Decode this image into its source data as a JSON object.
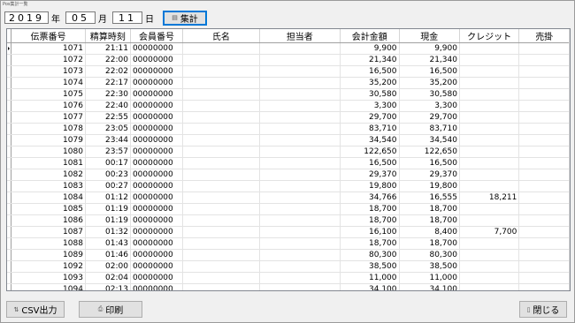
{
  "window_title": "Pos集計一覧",
  "date": {
    "year": "2019",
    "year_label": "年",
    "month": "05",
    "month_label": "月",
    "day": "11",
    "day_label": "日"
  },
  "aggregate_button": {
    "label": "集計",
    "icon": "aggregate-icon"
  },
  "table": {
    "columns": [
      "伝票番号",
      "精算時刻",
      "会員番号",
      "氏名",
      "担当者",
      "会計金額",
      "現金",
      "クレジット",
      "売掛"
    ],
    "rows": [
      [
        "1071",
        "21:11",
        "00000000",
        "",
        "",
        "9,900",
        "9,900",
        "",
        ""
      ],
      [
        "1072",
        "22:00",
        "00000000",
        "",
        "",
        "21,340",
        "21,340",
        "",
        ""
      ],
      [
        "1073",
        "22:02",
        "00000000",
        "",
        "",
        "16,500",
        "16,500",
        "",
        ""
      ],
      [
        "1074",
        "22:17",
        "00000000",
        "",
        "",
        "35,200",
        "35,200",
        "",
        ""
      ],
      [
        "1075",
        "22:30",
        "00000000",
        "",
        "",
        "30,580",
        "30,580",
        "",
        ""
      ],
      [
        "1076",
        "22:40",
        "00000000",
        "",
        "",
        "3,300",
        "3,300",
        "",
        ""
      ],
      [
        "1077",
        "22:55",
        "00000000",
        "",
        "",
        "29,700",
        "29,700",
        "",
        ""
      ],
      [
        "1078",
        "23:05",
        "00000000",
        "",
        "",
        "83,710",
        "83,710",
        "",
        ""
      ],
      [
        "1079",
        "23:44",
        "00000000",
        "",
        "",
        "34,540",
        "34,540",
        "",
        ""
      ],
      [
        "1080",
        "23:57",
        "00000000",
        "",
        "",
        "122,650",
        "122,650",
        "",
        ""
      ],
      [
        "1081",
        "00:17",
        "00000000",
        "",
        "",
        "16,500",
        "16,500",
        "",
        ""
      ],
      [
        "1082",
        "00:23",
        "00000000",
        "",
        "",
        "29,370",
        "29,370",
        "",
        ""
      ],
      [
        "1083",
        "00:27",
        "00000000",
        "",
        "",
        "19,800",
        "19,800",
        "",
        ""
      ],
      [
        "1084",
        "01:12",
        "00000000",
        "",
        "",
        "34,766",
        "16,555",
        "18,211",
        ""
      ],
      [
        "1085",
        "01:19",
        "00000000",
        "",
        "",
        "18,700",
        "18,700",
        "",
        ""
      ],
      [
        "1086",
        "01:19",
        "00000000",
        "",
        "",
        "18,700",
        "18,700",
        "",
        ""
      ],
      [
        "1087",
        "01:32",
        "00000000",
        "",
        "",
        "16,100",
        "8,400",
        "7,700",
        ""
      ],
      [
        "1088",
        "01:43",
        "00000000",
        "",
        "",
        "18,700",
        "18,700",
        "",
        ""
      ],
      [
        "1089",
        "01:46",
        "00000000",
        "",
        "",
        "80,300",
        "80,300",
        "",
        ""
      ],
      [
        "1092",
        "02:00",
        "00000000",
        "",
        "",
        "38,500",
        "38,500",
        "",
        ""
      ],
      [
        "1093",
        "02:04",
        "00000000",
        "",
        "",
        "11,000",
        "11,000",
        "",
        ""
      ],
      [
        "1094",
        "02:13",
        "00000000",
        "",
        "",
        "34,100",
        "34,100",
        "",
        ""
      ]
    ]
  },
  "csv_button": {
    "label": "CSV出力",
    "icon": "csv-icon"
  },
  "print_button": {
    "label": "印刷",
    "icon": "printer-icon"
  },
  "close_button": {
    "label": "閉じる",
    "icon": "door-icon"
  }
}
